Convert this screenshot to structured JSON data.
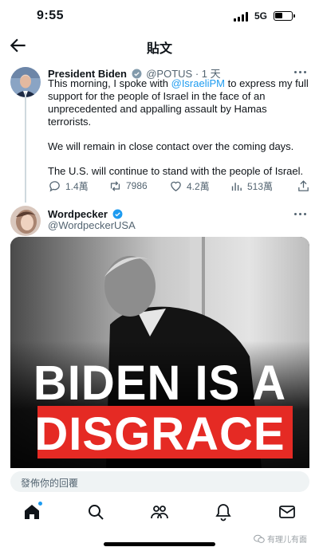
{
  "status_bar": {
    "time": "9:55",
    "network": "5G"
  },
  "header": {
    "title": "貼文"
  },
  "tweet": {
    "name": "President Biden",
    "handle": "@POTUS",
    "time": "· 1 天",
    "text_p1_before": "This morning, I spoke with ",
    "mention": "@IsraeliPM",
    "text_p1_after": " to express my full support for the people of Israel in the face of an unprecedented and appalling assault by Hamas terrorists.",
    "text_p2": "We will remain in close contact over the coming days.",
    "text_p3": "The U.S. will continue to stand with the people of Israel.",
    "replies": "1.4萬",
    "retweets": "7986",
    "likes": "4.2萬",
    "views": "513萬"
  },
  "reply_tweet": {
    "name": "Wordpecker",
    "handle": "@WordpeckerUSA",
    "image_text_line1": "BIDEN IS A",
    "image_text_line2": "DISGRACE"
  },
  "reply_input": {
    "placeholder": "發佈你的回覆"
  },
  "watermark": "有理儿有面",
  "colors": {
    "accent": "#1d9bf0",
    "secondary_text": "#536471",
    "banner_red": "#e52a24"
  },
  "tabs": [
    "home-icon",
    "search-icon",
    "communities-icon",
    "notifications-icon",
    "messages-icon"
  ]
}
